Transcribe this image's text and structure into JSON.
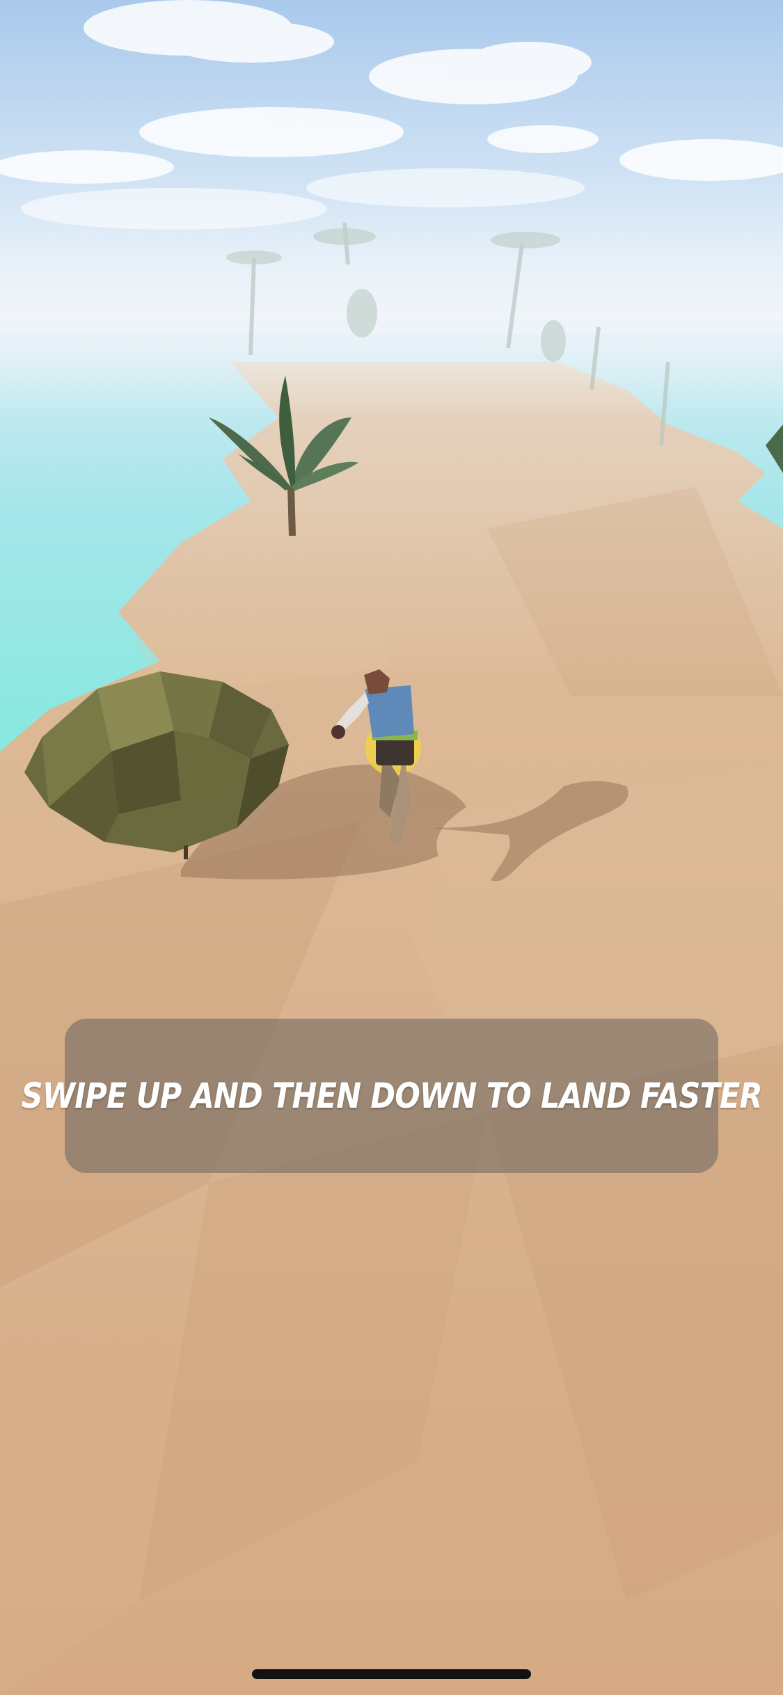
{
  "tutorial": {
    "hint_text": "SWIPE UP AND THEN DOWN TO LAND FASTER"
  },
  "icons": {
    "player": "runner-character-icon",
    "obstacle": "bush-icon"
  },
  "colors": {
    "sand": "#d3a882",
    "sea": "#8ee8e0",
    "sky": "#bcd8f2",
    "bush": "#6b6a3e",
    "panel": "#766c64",
    "text": "#ffffff"
  }
}
